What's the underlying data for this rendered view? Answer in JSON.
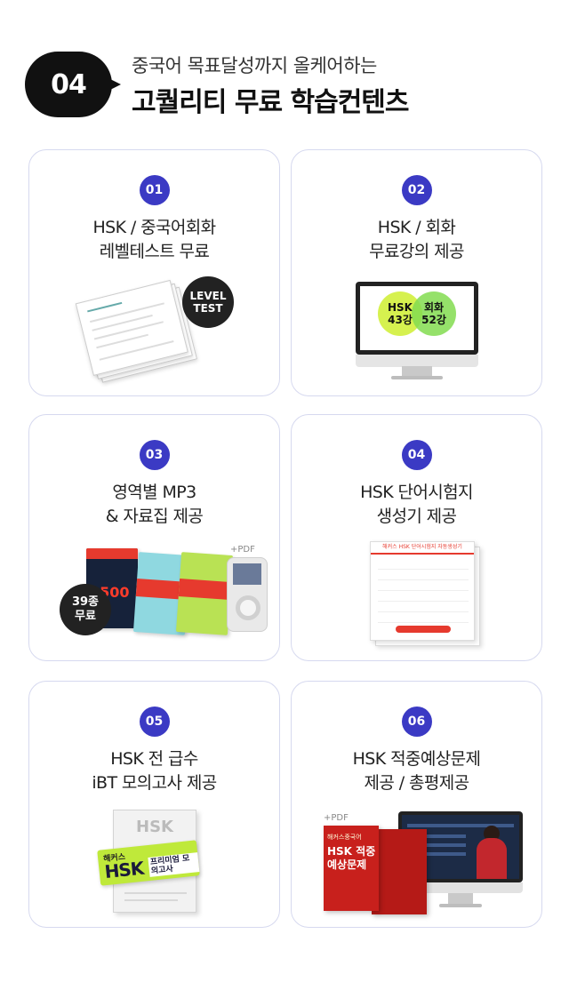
{
  "header": {
    "number": "04",
    "subtitle": "중국어 목표달성까지 올케어하는",
    "title": "고퀄리티 무료 학습컨텐츠"
  },
  "cards": [
    {
      "badge": "01",
      "title_line1": "HSK / 중국어회화",
      "title_line2": "레벨테스트 무료",
      "illus": {
        "circle_line1": "LEVEL",
        "circle_line2": "TEST"
      }
    },
    {
      "badge": "02",
      "title_line1": "HSK / 회화",
      "title_line2": "무료강의 제공",
      "illus": {
        "a_line1": "HSK",
        "a_line2": "43강",
        "b_line1": "회화",
        "b_line2": "52강"
      }
    },
    {
      "badge": "03",
      "title_line1": "영역별 MP3",
      "title_line2": "& 자료집 제공",
      "illus": {
        "pdf": "+PDF",
        "circle_line1": "39종",
        "circle_line2": "무료",
        "book_text": "1500"
      }
    },
    {
      "badge": "04",
      "title_line1": "HSK 단어시험지",
      "title_line2": "생성기 제공",
      "illus": {
        "sheet_header": "해커스 HSK 단어시험지 자동생성기"
      }
    },
    {
      "badge": "05",
      "title_line1": "HSK 전 급수",
      "title_line2": "iBT 모의고사 제공",
      "illus": {
        "book_title": "HSK",
        "ribbon_brand": "해커스",
        "ribbon_main": "HSK",
        "ribbon_tag": "프리미엄 모의고사"
      }
    },
    {
      "badge": "06",
      "title_line1": "HSK 적중예상문제",
      "title_line2": "제공 / 총평제공",
      "illus": {
        "pdf": "+PDF",
        "book_brand": "해커스중국어",
        "book_title": "HSK 적중 예상문제"
      }
    }
  ],
  "colors": {
    "badge": "#3b3ac4",
    "card_border": "#d6d9ef",
    "accent_red": "#e63a2e"
  }
}
